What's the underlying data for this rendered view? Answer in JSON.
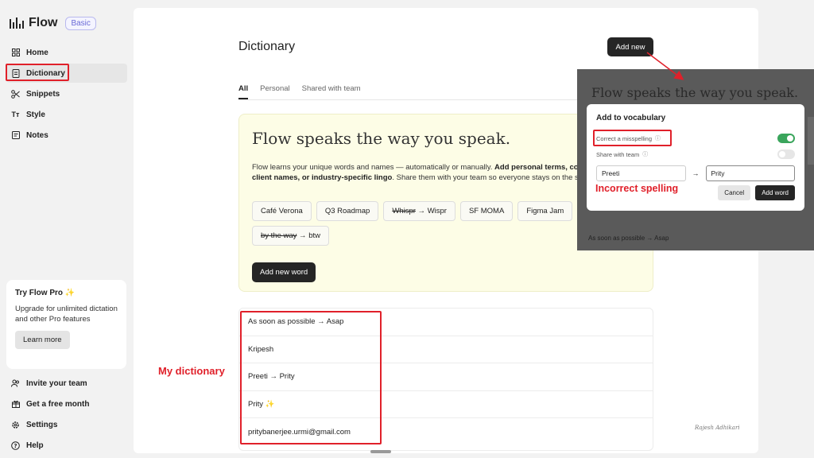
{
  "brand": {
    "name": "Flow",
    "plan": "Basic"
  },
  "sidebar": {
    "items": [
      {
        "label": "Home",
        "icon": "grid-icon"
      },
      {
        "label": "Dictionary",
        "icon": "book-icon"
      },
      {
        "label": "Snippets",
        "icon": "scissors-icon"
      },
      {
        "label": "Style",
        "icon": "text-style-icon"
      },
      {
        "label": "Notes",
        "icon": "note-icon"
      }
    ],
    "bottom_items": [
      {
        "label": "Invite your team",
        "icon": "users-icon"
      },
      {
        "label": "Get a free month",
        "icon": "gift-icon"
      },
      {
        "label": "Settings",
        "icon": "gear-icon"
      },
      {
        "label": "Help",
        "icon": "help-icon"
      }
    ]
  },
  "promo": {
    "title": "Try Flow Pro ✨",
    "text": "Upgrade for unlimited dictation and other Pro features",
    "button": "Learn more"
  },
  "main": {
    "title": "Dictionary",
    "add_new": "Add new",
    "tabs": [
      "All",
      "Personal",
      "Shared with team"
    ],
    "hero": {
      "title": "Flow speaks the way you speak.",
      "text_pre": "Flow learns your unique words and names — automatically or manually. ",
      "text_bold": "Add personal terms, company jargon, client names, or industry-specific lingo",
      "text_post": ". Share them with your team so everyone stays on the same page.",
      "chips": [
        {
          "text": "Café Verona"
        },
        {
          "text": "Q3 Roadmap"
        },
        {
          "from": "Whispr",
          "to": "Wispr"
        },
        {
          "text": "SF MOMA"
        },
        {
          "text": "Figma Jam"
        },
        {
          "from": "by the way",
          "to": "btw"
        }
      ],
      "button": "Add new word"
    },
    "entries": [
      "As soon as possible → Asap",
      "Kripesh",
      "Preeti → Prity",
      "Prity ✨",
      "pritybanerjee.urmi@gmail.com"
    ],
    "signature": "Rajesh Adhikari"
  },
  "overlay": {
    "title": "Flow speaks the way you speak.",
    "modal_title": "Add to vocabulary",
    "option_misspelling": "Correct a misspelling",
    "option_share": "Share with team",
    "input_from": "Preeti",
    "input_to": "Prity",
    "cancel": "Cancel",
    "add_word": "Add word",
    "footer_entry": "As soon as possible → Asap"
  },
  "annotations": {
    "my_dictionary": "My dictionary",
    "incorrect_spelling": "Incorrect spelling"
  },
  "colors": {
    "annotation_red": "#e0202a",
    "toggle_green": "#3aa55c",
    "hero_bg": "#fdfde6"
  }
}
